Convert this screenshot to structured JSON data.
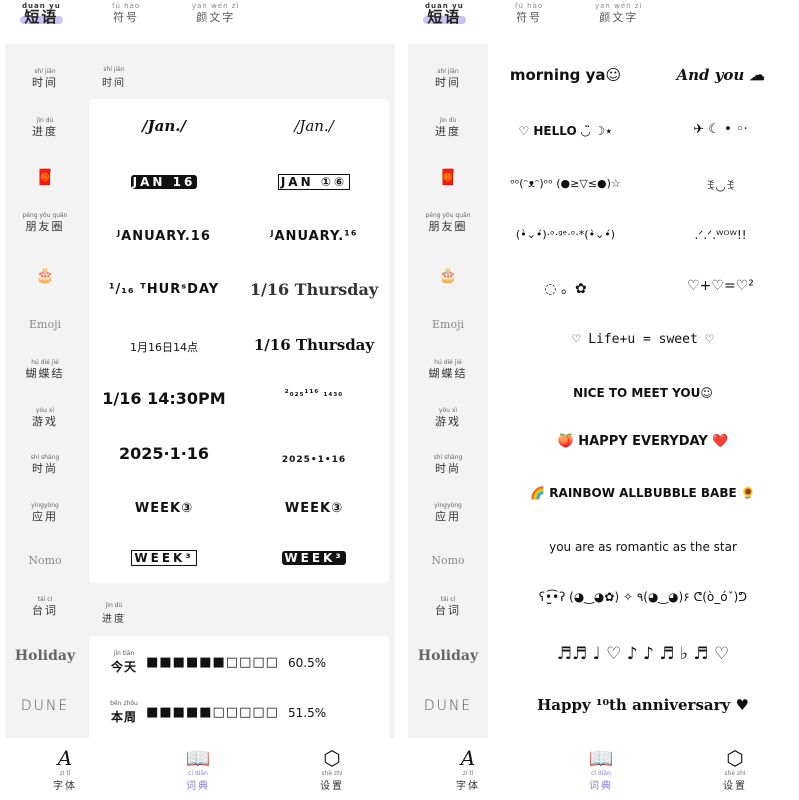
{
  "left": {
    "tabs": [
      {
        "py": "duan yu",
        "hz": "短语",
        "active": true
      },
      {
        "py": "fú hào",
        "hz": "符号",
        "active": false
      },
      {
        "py": "yan wén zì",
        "hz": "颜文字",
        "active": false
      }
    ],
    "sidebar": [
      {
        "py": "shí jiān",
        "hz": "时间"
      },
      {
        "py": "jìn dù",
        "hz": "进度"
      },
      {
        "emoji": "🧧"
      },
      {
        "py": "péng yǒu quān",
        "hz": "朋友圈"
      },
      {
        "emoji": "🎂"
      },
      {
        "en": "Emoji"
      },
      {
        "py": "hú dié jié",
        "hz": "蝴蝶结"
      },
      {
        "py": "yóu xì",
        "hz": "游戏"
      },
      {
        "py": "shí shàng",
        "hz": "时尚"
      },
      {
        "py": "yìngyòng",
        "hz": "应用"
      },
      {
        "en": "Nomo"
      },
      {
        "py": "tái cí",
        "hz": "台词"
      },
      {
        "en": "Holiday"
      },
      {
        "en": "DUNE"
      }
    ],
    "section_time": {
      "py": "shí jiān",
      "hz": "时间"
    },
    "time_rows": [
      [
        "/Jan./",
        "/Jan./"
      ],
      [
        "JAN 16",
        "JAN ①⑥"
      ],
      [
        "ᴶANUARY.16",
        "ᴶANUARY.¹⁶"
      ],
      [
        "¹/₁₆ ᵀHURˢDAY",
        "1/16 Thursday"
      ],
      [
        "1月16日14点",
        "1/16 Thursday"
      ],
      [
        "1/16 14:30PM",
        "²₀₂₅¹¹⁶ ₁₄₃₀"
      ],
      [
        "2025·1·16",
        "2025•1•16"
      ],
      [
        "WEEK③",
        "WEEK③"
      ],
      [
        "WEEK³",
        "WEEK³"
      ]
    ],
    "section_progress": {
      "py": "jìn dù",
      "hz": "进度"
    },
    "progress": [
      {
        "py": "jīn tiān",
        "hz": "今天",
        "bar": "■■■■■■□□□□",
        "pct": "60.5%"
      },
      {
        "py": "běn zhōu",
        "hz": "本周",
        "bar": "■■■■■□□□□□",
        "pct": "51.5%"
      }
    ]
  },
  "right": {
    "tabs": [
      {
        "py": "duan yu",
        "hz": "短语",
        "active": true
      },
      {
        "py": "fú hào",
        "hz": "符号",
        "active": false
      },
      {
        "py": "yan wén zì",
        "hz": "颜文字",
        "active": false
      }
    ],
    "sidebar": [
      {
        "py": "shí jiān",
        "hz": "时间"
      },
      {
        "py": "jìn dù",
        "hz": "进度"
      },
      {
        "emoji": "🧧"
      },
      {
        "py": "péng yǒu quān",
        "hz": "朋友圈"
      },
      {
        "emoji": "🎂"
      },
      {
        "en": "Emoji"
      },
      {
        "py": "hú dié jié",
        "hz": "蝴蝶结"
      },
      {
        "py": "yóu xì",
        "hz": "游戏"
      },
      {
        "py": "shí shàng",
        "hz": "时尚"
      },
      {
        "py": "yìngyòng",
        "hz": "应用"
      },
      {
        "en": "Nomo"
      },
      {
        "py": "tái cí",
        "hz": "台词"
      },
      {
        "en": "Holiday"
      },
      {
        "en": "DUNE"
      }
    ],
    "pair_rows": [
      [
        "morning ya☺",
        "And you ☁"
      ],
      [
        "♡ HELLO ◡̈ ☽⋆",
        "✈ ☾ • ◦·"
      ],
      [
        "ᵒᵒ(ᵔᴥᵔ)ᵒᵒ (●≥▽≤●)☆",
        "ꉂ◡ꉂ"
      ],
      [
        "(•̀⌄•́)·ᵒ·ᵍᵉ·ᵒ·*(•̀⌄•́)",
        ".ᐟ.ᐟ.ᵂᴼᵂ!!"
      ],
      [
        "◌ 。✿",
        "♡+♡=♡²"
      ]
    ],
    "single_rows": [
      "♡ Life+u = sweet ♡",
      "NICE TO MEET YOU☺",
      "🍑 HAPPY EVERYDAY ❤️",
      "🌈 RAINBOW ALLBUBBLE BABE 🌻",
      "you are as romantic as the star",
      "ʕ•̫͡•ʔ (◕‿◕✿) ✧ ٩(◕‿◕)۶ ᕦ(ò_óˇ)ᕤ",
      "♬♬ ♩ ♡ ♪ ♪ ♬ ♭ ♬ ♡",
      "Happy ¹⁰th anniversary ♥"
    ]
  },
  "bottom_nav": [
    {
      "icon": "font-icon",
      "glyph": "A",
      "py": "zì tǐ",
      "hz": "字体",
      "active": false
    },
    {
      "icon": "dictionary-icon",
      "glyph": "📖",
      "py": "cí diǎn",
      "hz": "词典",
      "active": true
    },
    {
      "icon": "settings-icon",
      "glyph": "⬡",
      "py": "shè zhì",
      "hz": "设置",
      "active": false
    }
  ],
  "colors": {
    "accent": "#8a7fd6",
    "tab_highlight": "#c9c4f2",
    "panel_bg": "#f3f3f3"
  }
}
